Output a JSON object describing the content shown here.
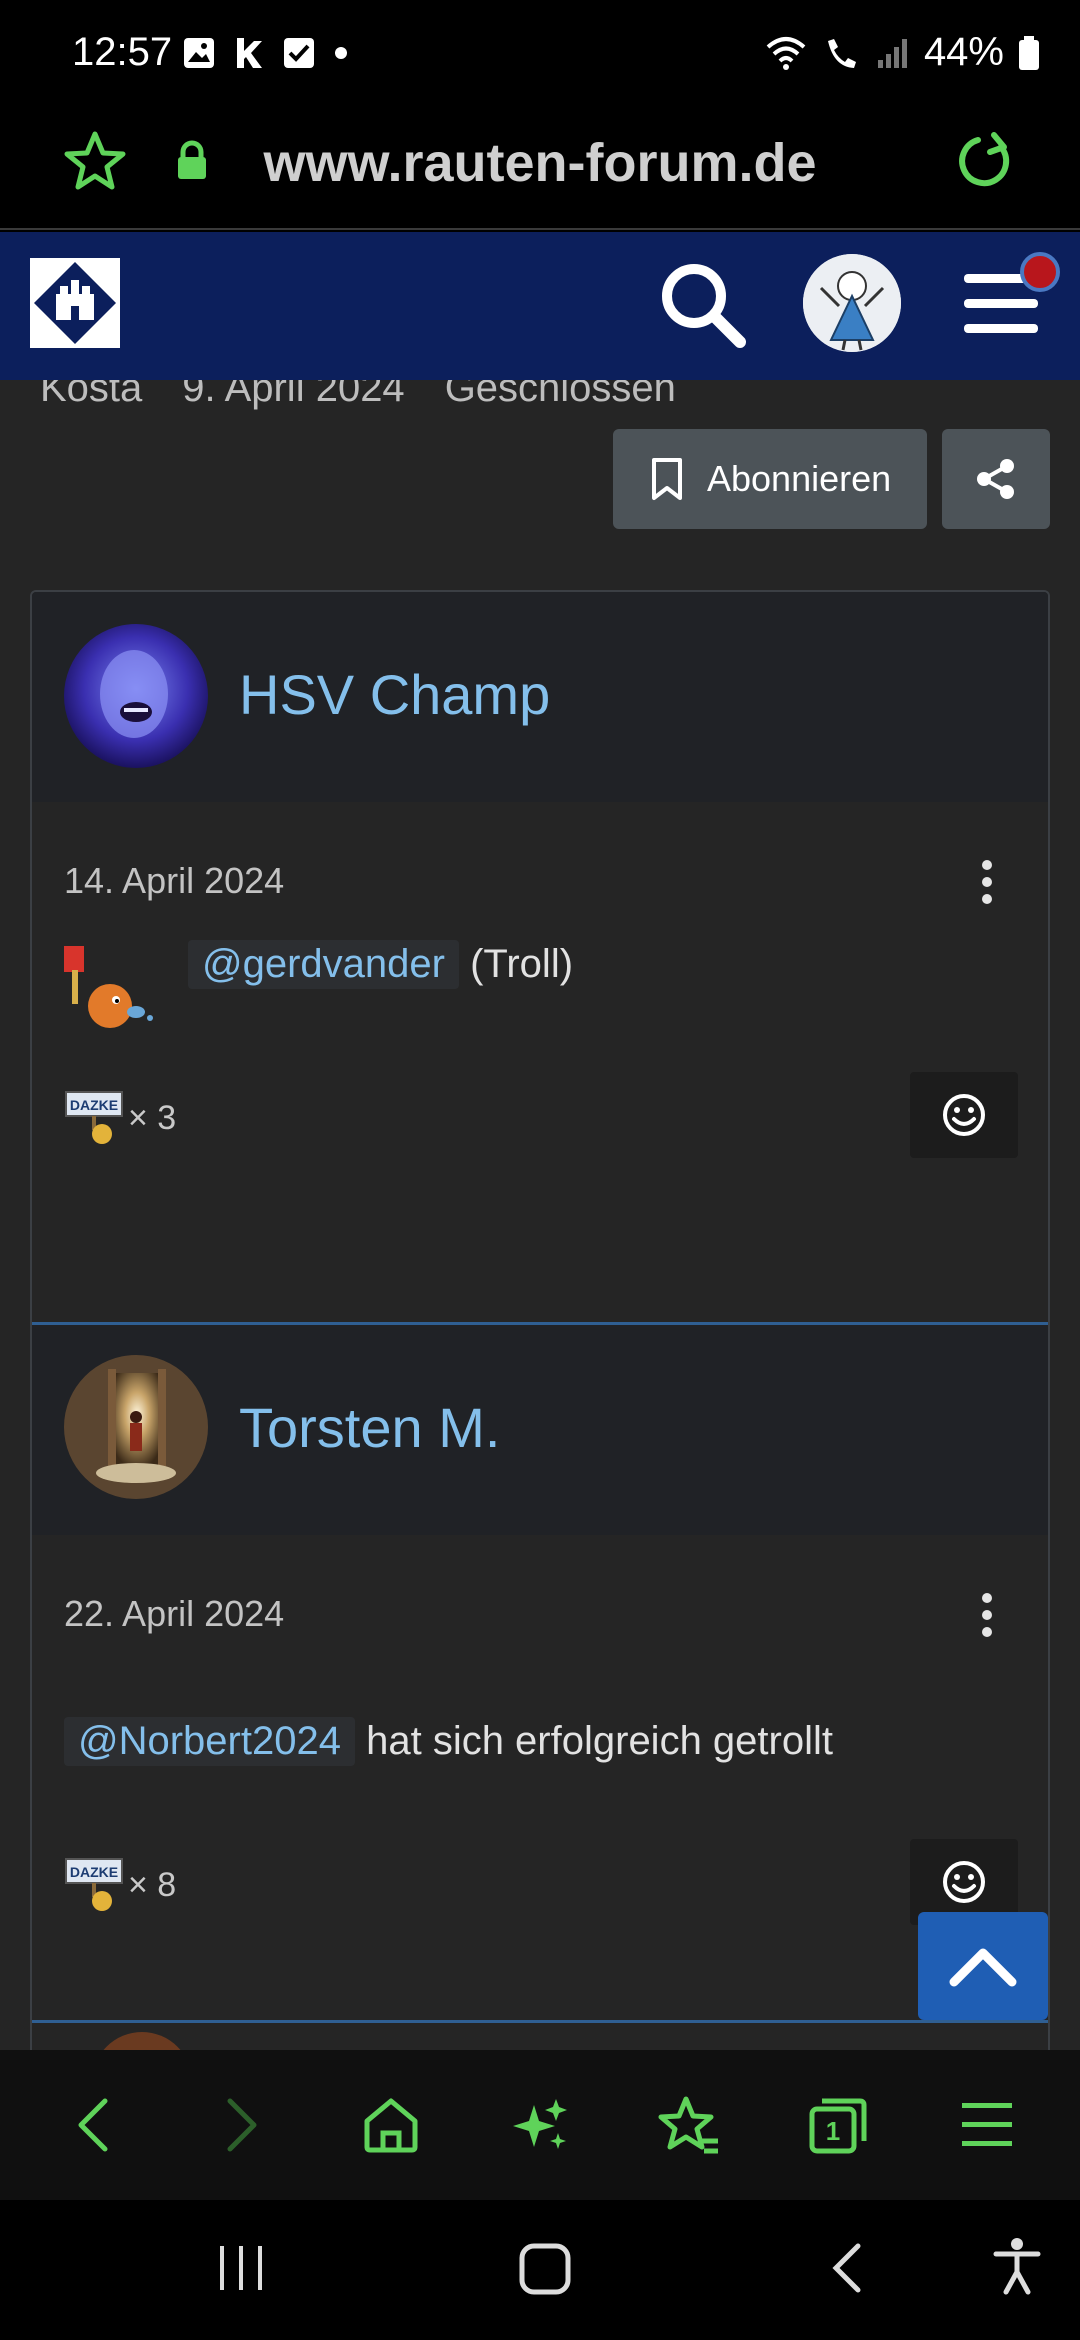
{
  "status_bar": {
    "time": "12:57",
    "battery": "44%"
  },
  "browser": {
    "url": "www.rauten-forum.de"
  },
  "thread_meta": {
    "author": "Kosta",
    "date": "9. April 2024",
    "status": "Geschlossen"
  },
  "actions": {
    "subscribe_label": "Abonnieren"
  },
  "posts": [
    {
      "username": "HSV Champ",
      "date": "14. April 2024",
      "mention": "@gerdvander",
      "text": "(Troll)",
      "reaction_label": "DAZKE",
      "reaction_count": "× 3"
    },
    {
      "username": "Torsten M.",
      "date": "22. April 2024",
      "mention": "@Norbert2024",
      "text": "hat sich erfolgreich getrollt",
      "reaction_label": "DAZKE",
      "reaction_count": "× 8"
    }
  ],
  "colors": {
    "header_bg": "#0c1f5c",
    "link": "#84bfeb",
    "browser_accent": "#5fd35a",
    "scroll_top_bg": "#1f5eb4",
    "notification": "#b8161c"
  },
  "icons": {
    "toolbar": [
      "back-icon",
      "forward-icon",
      "home-icon",
      "sparkle-icon",
      "bookmarks-icon",
      "tabs-icon",
      "menu-icon"
    ],
    "tabs_count": "1"
  }
}
